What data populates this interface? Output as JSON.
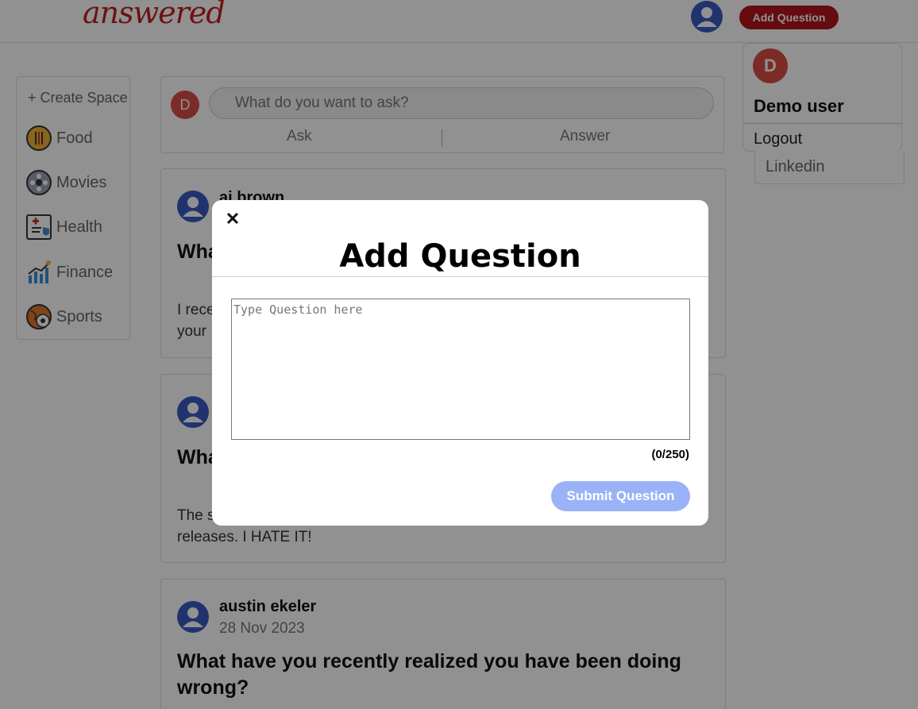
{
  "header": {
    "logo": "answered",
    "add_question_label": "Add Question",
    "avatar_icon": "user-icon"
  },
  "user_menu": {
    "initial": "D",
    "name": "Demo user",
    "logout": "Logout",
    "linkedin": "Linkedin"
  },
  "sidebar": {
    "create_space": "+ Create Space",
    "items": [
      {
        "label": "Food",
        "icon": "food-icon"
      },
      {
        "label": "Movies",
        "icon": "film-reel-icon"
      },
      {
        "label": "Health",
        "icon": "health-icon"
      },
      {
        "label": "Finance",
        "icon": "finance-chart-icon"
      },
      {
        "label": "Sports",
        "icon": "sports-balls-icon"
      }
    ]
  },
  "composer": {
    "initial": "D",
    "placeholder": "What do you want to ask?",
    "ask": "Ask",
    "answer": "Answer"
  },
  "posts": [
    {
      "author": "aj brown",
      "date": "",
      "title": "What",
      "body": "I rece\nyour"
    },
    {
      "author": "",
      "date": "",
      "title": "Wha",
      "body": "The s\nreleases. I HATE IT!"
    },
    {
      "author": "austin ekeler",
      "date": "28 Nov 2023",
      "title": "What have you recently realized you have been doing wrong?",
      "body": ""
    }
  ],
  "modal": {
    "close": "✕",
    "title": "Add Question",
    "textarea_placeholder": "Type Question here",
    "textarea_value": "",
    "char_count": "(0/250)",
    "submit_label": "Submit Question"
  },
  "colors": {
    "brand_red": "#b3141b",
    "avatar_blue": "#3b5bc4",
    "avatar_red": "#d84e43",
    "submit_disabled": "#9ab2f7"
  }
}
